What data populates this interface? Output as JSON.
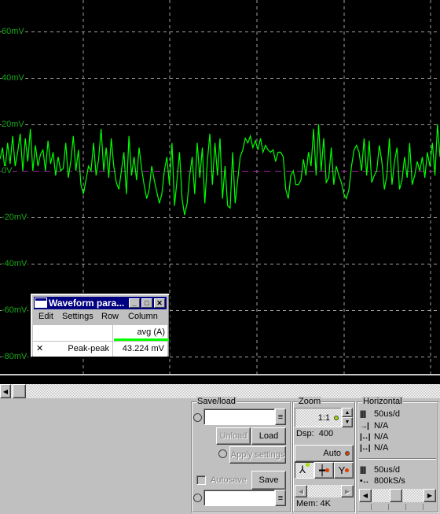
{
  "chart_data": {
    "type": "line",
    "y_tick_labels": [
      "60mV",
      "40mV",
      "20mV",
      "0V",
      "-20mV",
      "-40mV",
      "-60mV",
      "-80mV"
    ],
    "y_ticks": [
      60,
      40,
      20,
      0,
      -20,
      -40,
      -60,
      -80
    ],
    "ylim": [
      -88,
      73
    ],
    "grid": true,
    "trace_color": "#00ff00",
    "zero_line_color": "#a020a0",
    "values": [
      5,
      10,
      0,
      12,
      3,
      15,
      2,
      8,
      16,
      0,
      14,
      4,
      18,
      0,
      11,
      2,
      7,
      9,
      0,
      13,
      3,
      8,
      -2,
      6,
      0,
      1,
      12,
      -3,
      4,
      15,
      0,
      9,
      -6,
      -10,
      -4,
      2,
      0,
      12,
      -2,
      5,
      18,
      0,
      10,
      -3,
      14,
      2,
      -5,
      -8,
      0,
      8,
      -10,
      15,
      -2,
      6,
      -4,
      10,
      1,
      -6,
      -12,
      -8,
      2,
      -4,
      -9,
      -14,
      -10,
      0,
      6,
      -6,
      12,
      -15,
      -4,
      8,
      -12,
      -19,
      -14,
      -2,
      6,
      -10,
      12,
      -3,
      10,
      -14,
      4,
      16,
      -6,
      12,
      -2,
      14,
      -12,
      2,
      -15,
      -16,
      8,
      -14,
      -4,
      6,
      9,
      14,
      12,
      15,
      10,
      13,
      9,
      14,
      8,
      11,
      9,
      8,
      9,
      4,
      8,
      8,
      6,
      -8,
      -12,
      -2,
      0,
      -6,
      -6,
      -4,
      5,
      -2,
      8,
      2,
      18,
      -2,
      20,
      0,
      14,
      -5,
      -3,
      10,
      -6,
      2,
      -2,
      -5,
      -10,
      -12,
      -8,
      2,
      9,
      11,
      8,
      0,
      14,
      -2,
      13,
      -5,
      -2,
      0,
      11,
      4,
      -8,
      -2,
      14,
      -6,
      4,
      10,
      -8,
      -4,
      6,
      -3,
      12,
      -6,
      -2,
      4,
      0,
      6,
      -3,
      8,
      2,
      12,
      -2,
      20,
      6
    ]
  },
  "params_window": {
    "title": "Waveform para...",
    "menu": [
      "Edit",
      "Settings",
      "Row",
      "Column"
    ],
    "column_header": "avg (A)",
    "column_color": "#00ff00",
    "row_mark": "✕",
    "row_label": "Peak-peak",
    "row_value": "43.224 mV"
  },
  "save_load": {
    "title": "Save/load",
    "load_path": "",
    "save_path": "",
    "unload": "Unload",
    "load": "Load",
    "apply_settings": "Apply settings",
    "autosave": "Autosave",
    "save": "Save"
  },
  "zoom": {
    "title": "Zoom",
    "ratio": "1:1",
    "dsp": "Dsp:  400",
    "auto": "Auto",
    "mem": "Mem: 4K",
    "indicator_green": "#a0e000",
    "indicator_red": "#e04000"
  },
  "horizontal": {
    "title": "Horizontal",
    "timebase": "50us/d",
    "pos1": "N/A",
    "pos2": "N/A",
    "pos3": "N/A",
    "timebase2": "50us/d",
    "sample_rate": "800kS/s",
    "slider_position": 0.45
  }
}
